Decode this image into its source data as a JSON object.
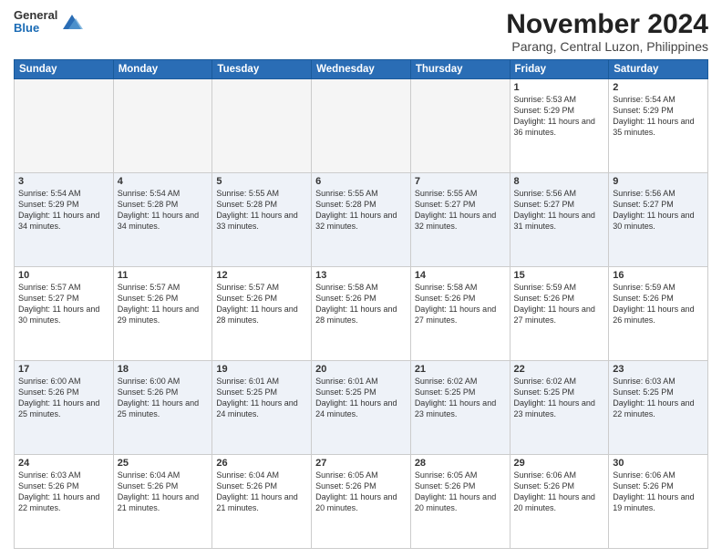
{
  "header": {
    "logo": {
      "general": "General",
      "blue": "Blue"
    },
    "title": "November 2024",
    "subtitle": "Parang, Central Luzon, Philippines"
  },
  "calendar": {
    "days_of_week": [
      "Sunday",
      "Monday",
      "Tuesday",
      "Wednesday",
      "Thursday",
      "Friday",
      "Saturday"
    ],
    "weeks": [
      [
        {
          "day": "",
          "empty": true
        },
        {
          "day": "",
          "empty": true
        },
        {
          "day": "",
          "empty": true
        },
        {
          "day": "",
          "empty": true
        },
        {
          "day": "",
          "empty": true
        },
        {
          "day": "1",
          "sunrise": "5:53 AM",
          "sunset": "5:29 PM",
          "daylight": "11 hours and 36 minutes."
        },
        {
          "day": "2",
          "sunrise": "5:54 AM",
          "sunset": "5:29 PM",
          "daylight": "11 hours and 35 minutes."
        }
      ],
      [
        {
          "day": "3",
          "sunrise": "5:54 AM",
          "sunset": "5:29 PM",
          "daylight": "11 hours and 34 minutes."
        },
        {
          "day": "4",
          "sunrise": "5:54 AM",
          "sunset": "5:28 PM",
          "daylight": "11 hours and 34 minutes."
        },
        {
          "day": "5",
          "sunrise": "5:55 AM",
          "sunset": "5:28 PM",
          "daylight": "11 hours and 33 minutes."
        },
        {
          "day": "6",
          "sunrise": "5:55 AM",
          "sunset": "5:28 PM",
          "daylight": "11 hours and 32 minutes."
        },
        {
          "day": "7",
          "sunrise": "5:55 AM",
          "sunset": "5:27 PM",
          "daylight": "11 hours and 32 minutes."
        },
        {
          "day": "8",
          "sunrise": "5:56 AM",
          "sunset": "5:27 PM",
          "daylight": "11 hours and 31 minutes."
        },
        {
          "day": "9",
          "sunrise": "5:56 AM",
          "sunset": "5:27 PM",
          "daylight": "11 hours and 30 minutes."
        }
      ],
      [
        {
          "day": "10",
          "sunrise": "5:57 AM",
          "sunset": "5:27 PM",
          "daylight": "11 hours and 30 minutes."
        },
        {
          "day": "11",
          "sunrise": "5:57 AM",
          "sunset": "5:26 PM",
          "daylight": "11 hours and 29 minutes."
        },
        {
          "day": "12",
          "sunrise": "5:57 AM",
          "sunset": "5:26 PM",
          "daylight": "11 hours and 28 minutes."
        },
        {
          "day": "13",
          "sunrise": "5:58 AM",
          "sunset": "5:26 PM",
          "daylight": "11 hours and 28 minutes."
        },
        {
          "day": "14",
          "sunrise": "5:58 AM",
          "sunset": "5:26 PM",
          "daylight": "11 hours and 27 minutes."
        },
        {
          "day": "15",
          "sunrise": "5:59 AM",
          "sunset": "5:26 PM",
          "daylight": "11 hours and 27 minutes."
        },
        {
          "day": "16",
          "sunrise": "5:59 AM",
          "sunset": "5:26 PM",
          "daylight": "11 hours and 26 minutes."
        }
      ],
      [
        {
          "day": "17",
          "sunrise": "6:00 AM",
          "sunset": "5:26 PM",
          "daylight": "11 hours and 25 minutes."
        },
        {
          "day": "18",
          "sunrise": "6:00 AM",
          "sunset": "5:26 PM",
          "daylight": "11 hours and 25 minutes."
        },
        {
          "day": "19",
          "sunrise": "6:01 AM",
          "sunset": "5:25 PM",
          "daylight": "11 hours and 24 minutes."
        },
        {
          "day": "20",
          "sunrise": "6:01 AM",
          "sunset": "5:25 PM",
          "daylight": "11 hours and 24 minutes."
        },
        {
          "day": "21",
          "sunrise": "6:02 AM",
          "sunset": "5:25 PM",
          "daylight": "11 hours and 23 minutes."
        },
        {
          "day": "22",
          "sunrise": "6:02 AM",
          "sunset": "5:25 PM",
          "daylight": "11 hours and 23 minutes."
        },
        {
          "day": "23",
          "sunrise": "6:03 AM",
          "sunset": "5:25 PM",
          "daylight": "11 hours and 22 minutes."
        }
      ],
      [
        {
          "day": "24",
          "sunrise": "6:03 AM",
          "sunset": "5:26 PM",
          "daylight": "11 hours and 22 minutes."
        },
        {
          "day": "25",
          "sunrise": "6:04 AM",
          "sunset": "5:26 PM",
          "daylight": "11 hours and 21 minutes."
        },
        {
          "day": "26",
          "sunrise": "6:04 AM",
          "sunset": "5:26 PM",
          "daylight": "11 hours and 21 minutes."
        },
        {
          "day": "27",
          "sunrise": "6:05 AM",
          "sunset": "5:26 PM",
          "daylight": "11 hours and 20 minutes."
        },
        {
          "day": "28",
          "sunrise": "6:05 AM",
          "sunset": "5:26 PM",
          "daylight": "11 hours and 20 minutes."
        },
        {
          "day": "29",
          "sunrise": "6:06 AM",
          "sunset": "5:26 PM",
          "daylight": "11 hours and 20 minutes."
        },
        {
          "day": "30",
          "sunrise": "6:06 AM",
          "sunset": "5:26 PM",
          "daylight": "11 hours and 19 minutes."
        }
      ]
    ]
  }
}
